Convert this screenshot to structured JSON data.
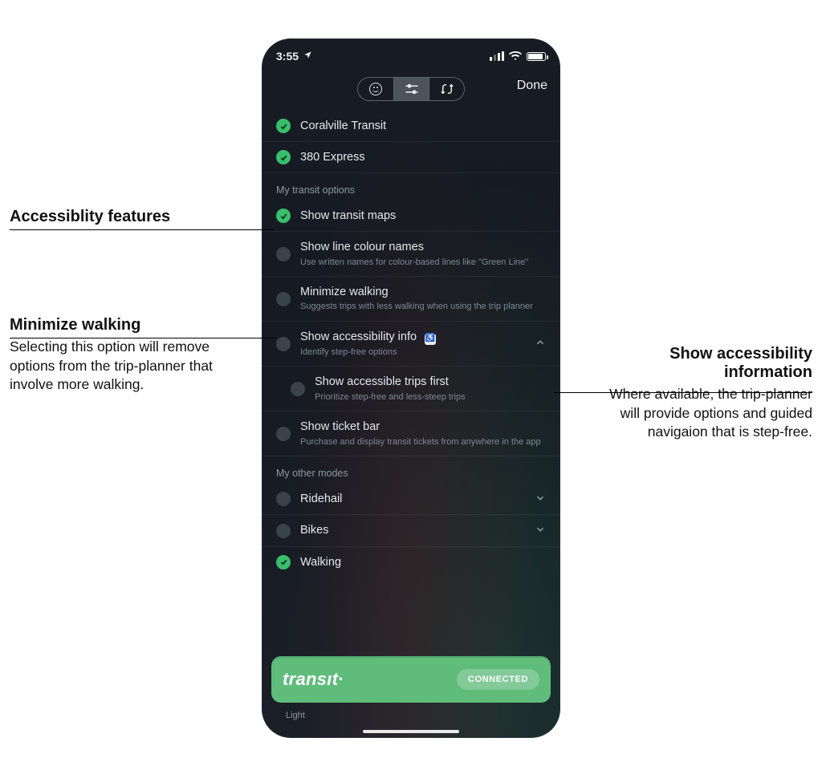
{
  "status": {
    "time": "3:55",
    "location_arrow": "◤"
  },
  "header": {
    "done": "Done",
    "seg": {
      "mood": "mood",
      "tune": "tune",
      "route": "route"
    }
  },
  "agencies": [
    {
      "label": "Coralville Transit",
      "checked": true
    },
    {
      "label": "380 Express",
      "checked": true
    }
  ],
  "sections": {
    "transit_options_h": "My transit options",
    "other_modes_h": "My other modes"
  },
  "options": {
    "show_maps": {
      "title": "Show transit maps",
      "checked": true
    },
    "line_colour": {
      "title": "Show line colour names",
      "sub": "Use written names for colour-based lines like \"Green Line\"",
      "checked": false
    },
    "min_walking": {
      "title": "Minimize walking",
      "sub": "Suggests trips with less walking when using the trip planner",
      "checked": false
    },
    "acc_info": {
      "title": "Show accessibility info",
      "sub": "Identify step-free options",
      "checked": false,
      "badge": "♿",
      "expanded": true
    },
    "acc_trips_first": {
      "title": "Show accessible trips first",
      "sub": "Prioritize step-free and less-steep trips",
      "checked": false
    },
    "ticket_bar": {
      "title": "Show ticket bar",
      "sub": "Purchase and display transit tickets from anywhere in the app",
      "checked": false
    }
  },
  "modes": {
    "ridehail": {
      "title": "Ridehail",
      "checked": false,
      "expandable": true
    },
    "bikes": {
      "title": "Bikes",
      "checked": false,
      "expandable": true
    },
    "walking": {
      "title": "Walking",
      "checked": true,
      "expandable": false
    }
  },
  "banner": {
    "brand": "transıt",
    "dot": "·",
    "status": "CONNECTED"
  },
  "under_banner": "Light",
  "callouts": {
    "acc_features": {
      "hd": "Accessiblity features"
    },
    "min_walk": {
      "hd": "Minimize walking",
      "bd": "Selecting this option will remove options from the trip-planner that involve more walking."
    },
    "show_acc": {
      "hd": "Show accessibility information",
      "bd": "Where available, the trip-planner will provide options and guided navigaion that is step-free."
    }
  }
}
